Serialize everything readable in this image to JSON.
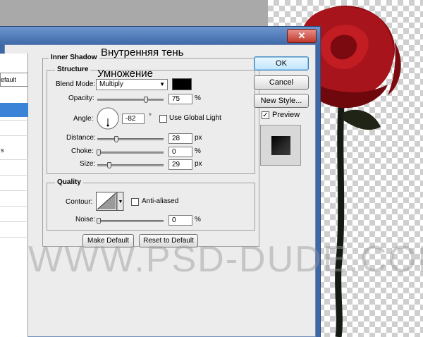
{
  "overlay": {
    "inner_shadow_ru": "Внутренняя тень",
    "multiply_ru": "Умножение",
    "watermark": "WWW.PSD-DUDE.COM"
  },
  "titlebar": {
    "close_glyph": "✕"
  },
  "left_panel": {
    "default_label": "efault",
    "item_a": "s"
  },
  "inner_shadow": {
    "section_title": "Inner Shadow",
    "structure": {
      "title": "Structure",
      "blend_mode_label": "Blend Mode:",
      "blend_mode_value": "Multiply",
      "blend_color": "#000000",
      "opacity_label": "Opacity:",
      "opacity_value": "75",
      "opacity_unit": "%",
      "angle_label": "Angle:",
      "angle_value": "-82",
      "angle_unit": "°",
      "use_global_light_label": "Use Global Light",
      "use_global_light_checked": false,
      "distance_label": "Distance:",
      "distance_value": "28",
      "distance_unit": "px",
      "choke_label": "Choke:",
      "choke_value": "0",
      "choke_unit": "%",
      "size_label": "Size:",
      "size_value": "29",
      "size_unit": "px"
    },
    "quality": {
      "title": "Quality",
      "contour_label": "Contour:",
      "anti_aliased_label": "Anti-aliased",
      "anti_aliased_checked": false,
      "noise_label": "Noise:",
      "noise_value": "0",
      "noise_unit": "%"
    },
    "make_default_label": "Make Default",
    "reset_default_label": "Reset to Default"
  },
  "actions": {
    "ok_label": "OK",
    "cancel_label": "Cancel",
    "new_style_label": "New Style...",
    "preview_label": "Preview",
    "preview_checked": true
  },
  "colors": {
    "title_blue": "#3e68a6",
    "accent_select": "#3a83d6",
    "rose_red": "#b0121a"
  },
  "sliders": {
    "opacity": 0.75,
    "distance": 0.11,
    "choke": 0.0,
    "size": 0.12,
    "noise": 0.0
  }
}
